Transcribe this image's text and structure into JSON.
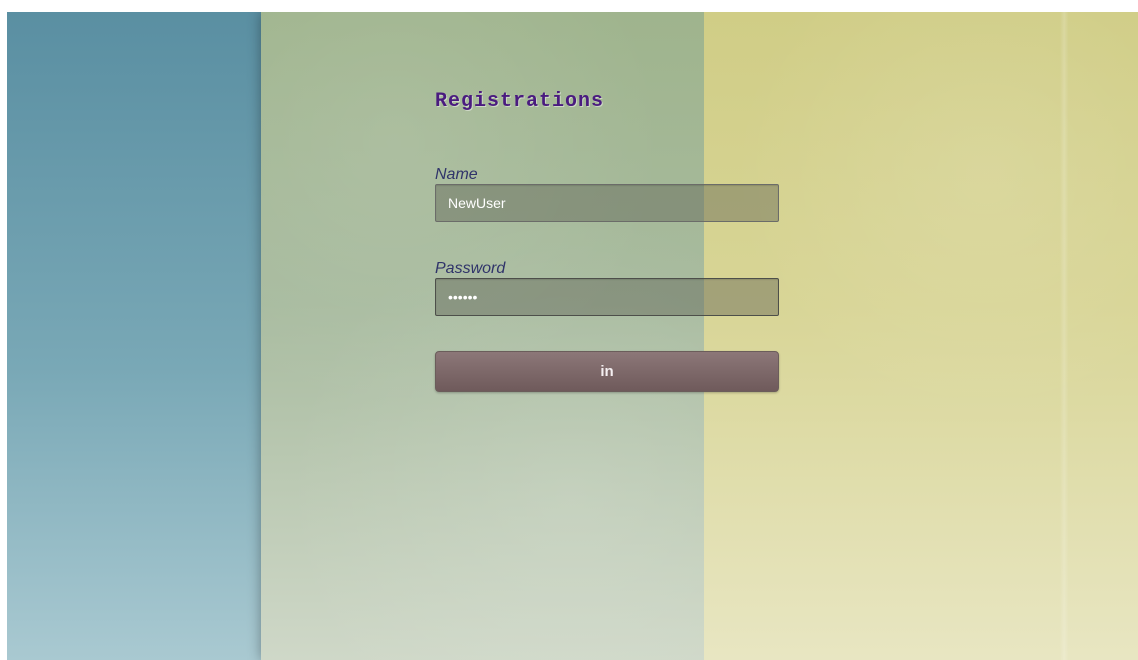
{
  "app": {
    "title": "Registrations"
  },
  "form": {
    "name_label": "Name",
    "name_value": "NewUser",
    "password_label": "Password",
    "password_value": "••••••",
    "submit_label": "in"
  },
  "colors": {
    "left_panel": "#5f93a3",
    "middle_panel": "#9fb48d",
    "right_panel": "#d0cd86",
    "title": "#4a1b7f",
    "label": "#30346a",
    "button": "#7f6b6c"
  }
}
